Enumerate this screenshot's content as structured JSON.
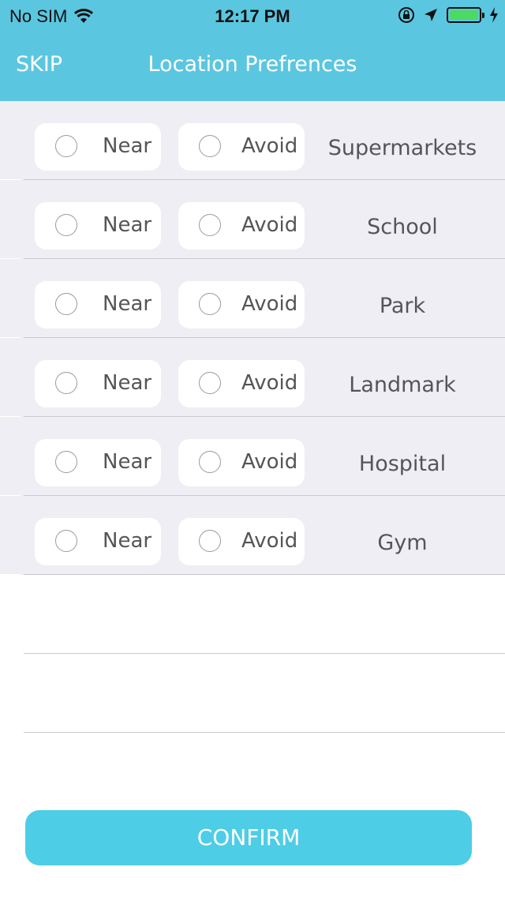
{
  "status_bar": {
    "carrier": "No SIM",
    "time": "12:17 PM",
    "battery_level": 1.0
  },
  "nav": {
    "skip_label": "SKIP",
    "title": "Location Prefrences"
  },
  "options": {
    "near_label": "Near",
    "avoid_label": "Avoid"
  },
  "rows": [
    {
      "place": "Supermarkets"
    },
    {
      "place": "School"
    },
    {
      "place": "Park"
    },
    {
      "place": "Landmark"
    },
    {
      "place": "Hospital"
    },
    {
      "place": "Gym"
    }
  ],
  "confirm_label": "CONFIRM",
  "colors": {
    "header": "#5bc6e0",
    "button": "#4ecde6",
    "row_bg": "#eeeef4"
  }
}
